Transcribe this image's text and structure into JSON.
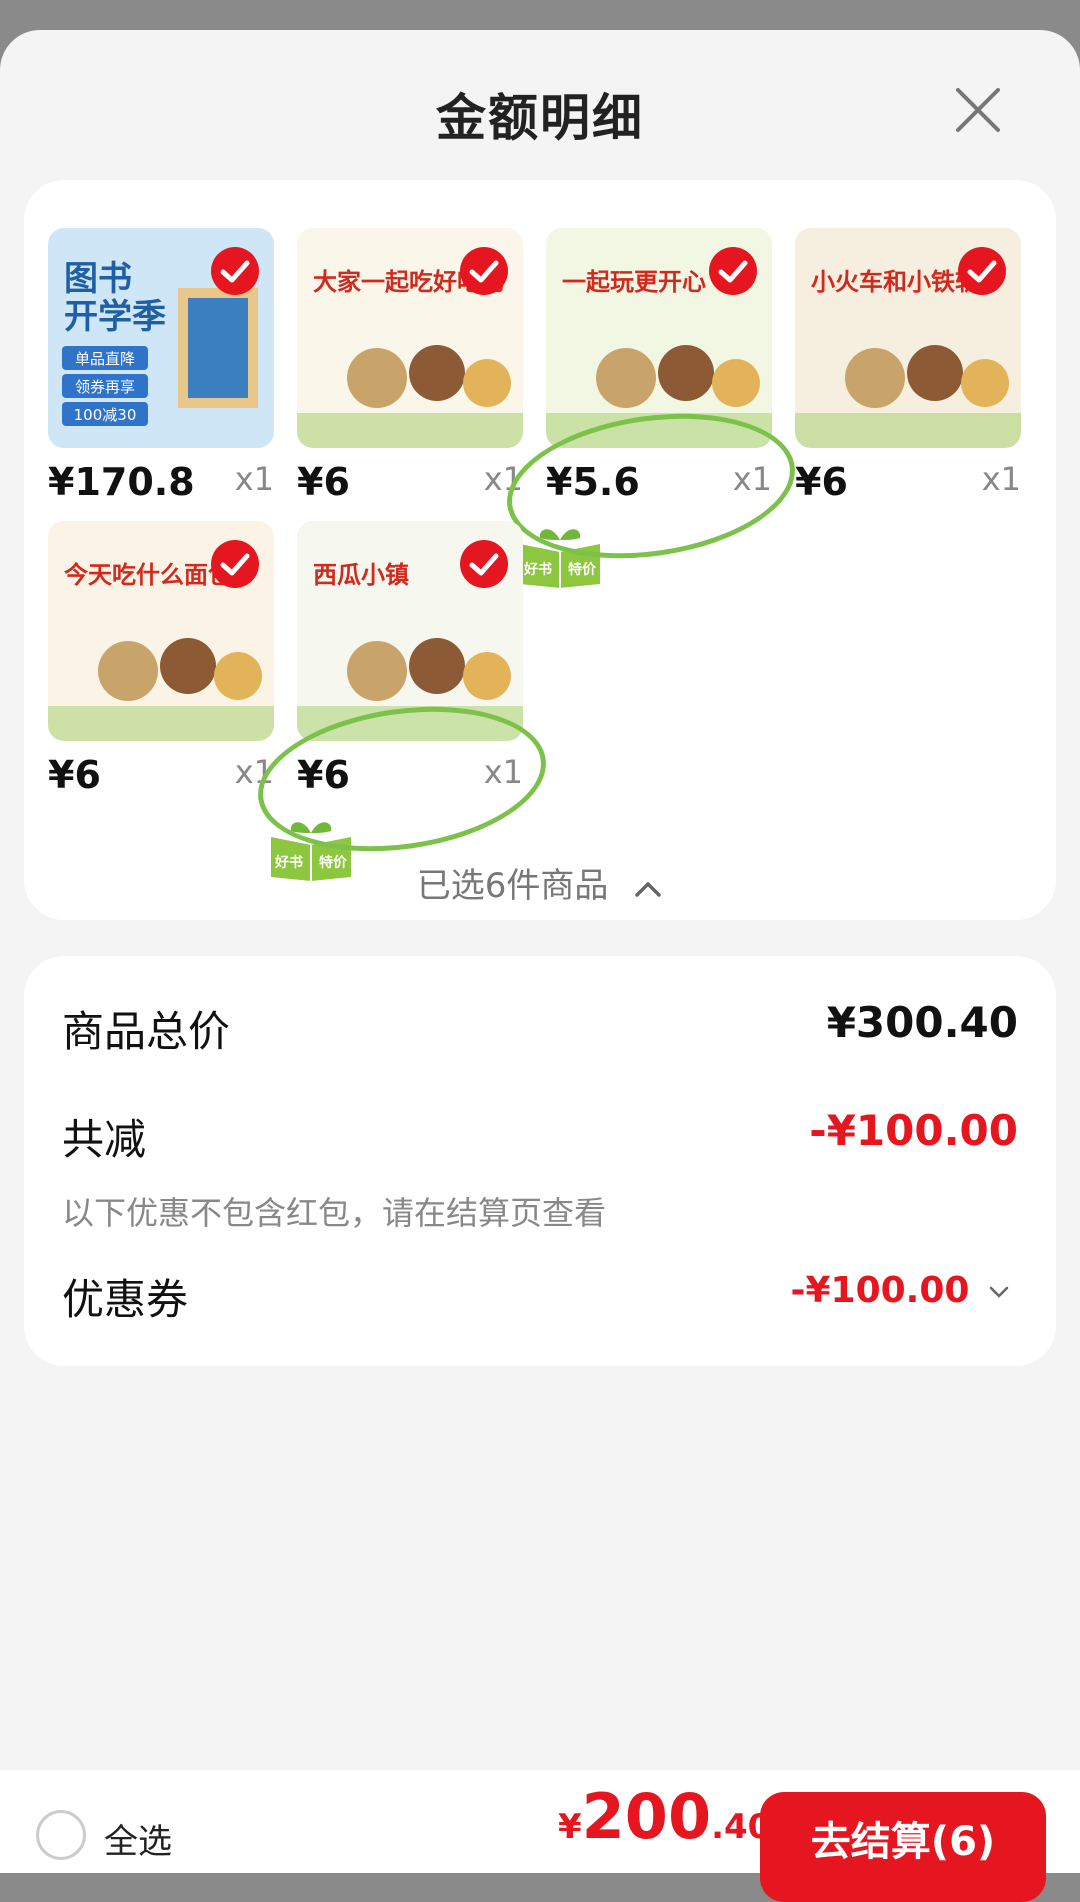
{
  "header": {
    "title": "金额明细"
  },
  "items": [
    {
      "price": "¥170.8",
      "qty": "x1",
      "cover_text": [
        "图书",
        "开学季"
      ],
      "sub_text": [
        "单品直降",
        "领券再享",
        "100减30"
      ],
      "color": "#cfe6f6",
      "badge": false
    },
    {
      "price": "¥6",
      "qty": "x1",
      "cover_text": [
        "大家一起吃好吃的"
      ],
      "color": "#fbf6ea",
      "badge": false
    },
    {
      "price": "¥5.6",
      "qty": "x1",
      "cover_text": [
        "一起玩更开心"
      ],
      "color": "#f2f7e4",
      "badge": true
    },
    {
      "price": "¥6",
      "qty": "x1",
      "cover_text": [
        "小火车和小铁轨"
      ],
      "color": "#f6efe0",
      "badge": false
    },
    {
      "price": "¥6",
      "qty": "x1",
      "cover_text": [
        "今天吃什么面包"
      ],
      "color": "#fbf4e6",
      "badge": false
    },
    {
      "price": "¥6",
      "qty": "x1",
      "cover_text": [
        "西瓜小镇"
      ],
      "color": "#f6f7ef",
      "badge": true
    }
  ],
  "badge_text": [
    "好书",
    "特价"
  ],
  "selected_text": "已选6件商品",
  "summary": {
    "total_label": "商品总价",
    "total_value": "¥300.40",
    "discount_label": "共减",
    "discount_value": "-¥100.00",
    "discount_note": "以下优惠不包含红包，请在结算页查看",
    "coupon_label": "优惠券",
    "coupon_value": "-¥100.00"
  },
  "bottom": {
    "select_all": "全选",
    "total_currency": "¥",
    "total_int": "200",
    "total_dec": ".40",
    "pay_label": "去结算(6)"
  },
  "colors": {
    "accent": "#e5161f",
    "badge_green": "#8dc63f"
  }
}
